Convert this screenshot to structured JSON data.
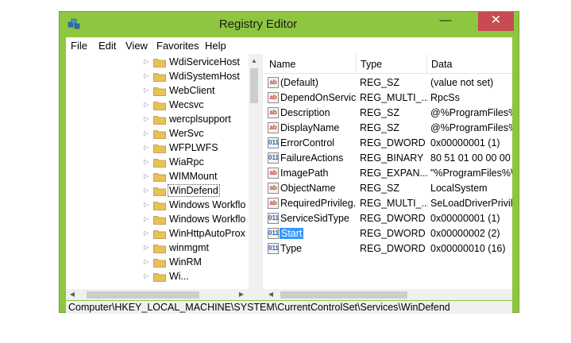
{
  "window": {
    "title": "Registry Editor",
    "minimize_glyph": "—",
    "maximize_glyph": "☐",
    "close_glyph": "✕"
  },
  "menu": [
    "File",
    "Edit",
    "View",
    "Favorites",
    "Help"
  ],
  "tree": {
    "expander_glyph": "▷",
    "items": [
      {
        "label": "WdiServiceHost"
      },
      {
        "label": "WdiSystemHost"
      },
      {
        "label": "WebClient"
      },
      {
        "label": "Wecsvc"
      },
      {
        "label": "wercplsupport"
      },
      {
        "label": "WerSvc"
      },
      {
        "label": "WFPLWFS"
      },
      {
        "label": "WiaRpc"
      },
      {
        "label": "WIMMount"
      },
      {
        "label": "WinDefend",
        "selected": true
      },
      {
        "label": "Windows Workflo"
      },
      {
        "label": "Windows Workflo"
      },
      {
        "label": "WinHttpAutoProx"
      },
      {
        "label": "winmgmt"
      },
      {
        "label": "WinRM"
      },
      {
        "label": "Wi..."
      }
    ]
  },
  "list": {
    "columns": [
      "Name",
      "Type",
      "Data"
    ],
    "rows": [
      {
        "name": "(Default)",
        "type": "REG_SZ",
        "data": "(value not set)",
        "icon": "string-value-icon"
      },
      {
        "name": "DependOnService",
        "type": "REG_MULTI_...",
        "data": "RpcSs",
        "icon": "string-value-icon"
      },
      {
        "name": "Description",
        "type": "REG_SZ",
        "data": "@%ProgramFiles%",
        "icon": "string-value-icon"
      },
      {
        "name": "DisplayName",
        "type": "REG_SZ",
        "data": "@%ProgramFiles%",
        "icon": "string-value-icon"
      },
      {
        "name": "ErrorControl",
        "type": "REG_DWORD",
        "data": "0x00000001 (1)",
        "icon": "binary-value-icon"
      },
      {
        "name": "FailureActions",
        "type": "REG_BINARY",
        "data": "80 51 01 00 00 00 00",
        "icon": "binary-value-icon"
      },
      {
        "name": "ImagePath",
        "type": "REG_EXPAN...",
        "data": "\"%ProgramFiles%\\",
        "icon": "string-value-icon"
      },
      {
        "name": "ObjectName",
        "type": "REG_SZ",
        "data": "LocalSystem",
        "icon": "string-value-icon"
      },
      {
        "name": "RequiredPrivileg...",
        "type": "REG_MULTI_...",
        "data": "SeLoadDriverPrivile",
        "icon": "string-value-icon"
      },
      {
        "name": "ServiceSidType",
        "type": "REG_DWORD",
        "data": "0x00000001 (1)",
        "icon": "binary-value-icon"
      },
      {
        "name": "Start",
        "type": "REG_DWORD",
        "data": "0x00000002 (2)",
        "icon": "binary-value-icon",
        "selected": true
      },
      {
        "name": "Type",
        "type": "REG_DWORD",
        "data": "0x00000010 (16)",
        "icon": "binary-value-icon"
      }
    ]
  },
  "icons": {
    "string": "ab",
    "binary": "011"
  },
  "scroll": {
    "up": "▲",
    "down": "▼",
    "left": "◀",
    "right": "▶"
  },
  "status": {
    "path": "Computer\\HKEY_LOCAL_MACHINE\\SYSTEM\\CurrentControlSet\\Services\\WinDefend"
  },
  "colors": {
    "titlebar": "#8ec63f",
    "close": "#c74b50",
    "selection": "#3399ff",
    "folder": "#e8c15a"
  }
}
